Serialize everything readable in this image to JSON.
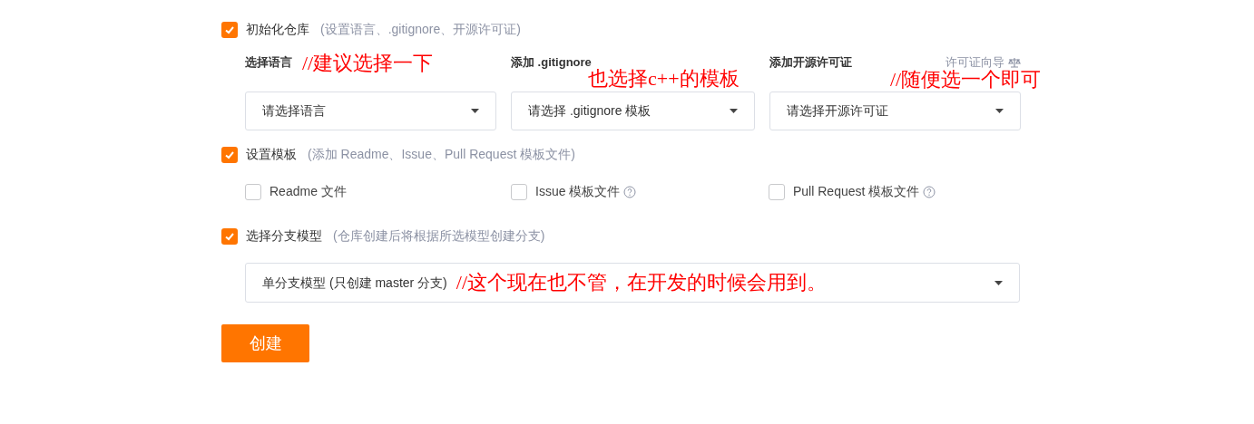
{
  "sections": [
    {
      "label": "初始化仓库",
      "hint": "(设置语言、.gitignore、开源许可证)",
      "checked": true
    },
    {
      "label": "设置模板",
      "hint": "(添加 Readme、Issue、Pull Request 模板文件)",
      "checked": true
    },
    {
      "label": "选择分支模型",
      "hint": "(仓库创建后将根据所选模型创建分支)",
      "checked": true
    }
  ],
  "init_fields": [
    {
      "label": "选择语言",
      "placeholder": "请选择语言",
      "annotation": "//建议选择一下"
    },
    {
      "label": "添加 .gitignore",
      "placeholder": "请选择 .gitignore 模板",
      "annotation": "也选择c++的模板"
    },
    {
      "label": "添加开源许可证",
      "placeholder": "请选择开源许可证",
      "annotation": "//随便选一个即可",
      "link": "许可证向导"
    }
  ],
  "template_options": [
    {
      "label": "Readme 文件",
      "checked": false,
      "help": false
    },
    {
      "label": "Issue 模板文件",
      "checked": false,
      "help": true
    },
    {
      "label": "Pull Request 模板文件",
      "checked": false,
      "help": true
    }
  ],
  "branch_select": {
    "value": "单分支模型 (只创建 master 分支)",
    "annotation": "//这个现在也不管，在开发的时候会用到。"
  },
  "create_button": "创建"
}
